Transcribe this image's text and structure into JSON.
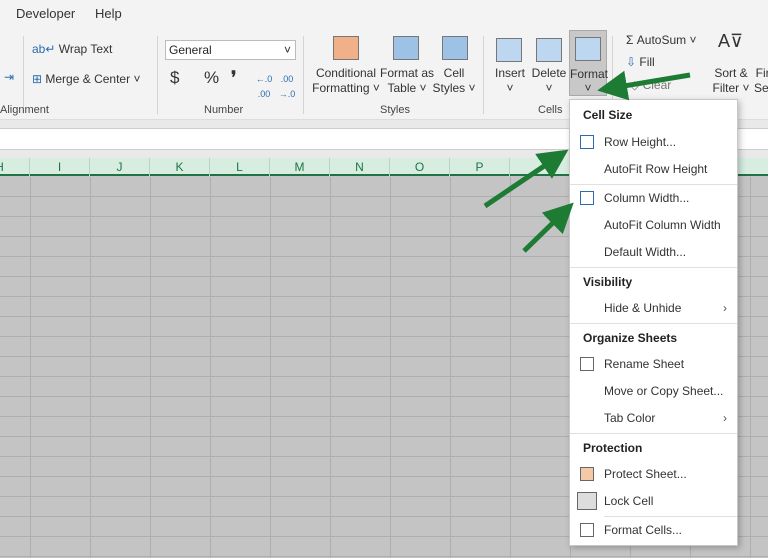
{
  "tabs": [
    "Developer",
    "Help"
  ],
  "ribbon": {
    "wrap_text": "Wrap Text",
    "merge_center": "Merge & Center",
    "alignment": "Alignment",
    "number_format": "General",
    "currency": "$",
    "percent": "%",
    "comma": "❜",
    "inc_dec": "←.0 .00",
    "dec_dec": ".00 →.0",
    "number": "Number",
    "conditional": [
      "Conditional",
      "Formatting ˅"
    ],
    "format_table": [
      "Format as",
      "Table ˅"
    ],
    "cell_styles": [
      "Cell",
      "Styles ˅"
    ],
    "styles": "Styles",
    "insert": "Insert",
    "delete": "Delete",
    "format": "Format",
    "cells": "Cells",
    "autosum": "AutoSum",
    "fill": "Fill",
    "clear": "Clear",
    "sort": [
      "Sort &",
      "Filter ˅"
    ],
    "find": [
      "Fir",
      "Sel"
    ],
    "chev": "˅"
  },
  "columns": [
    "H",
    "I",
    "J",
    "K",
    "L",
    "M",
    "N",
    "O",
    "P"
  ],
  "menu": {
    "cell_size": "Cell Size",
    "row_height": "Row Height...",
    "autofit_row": "AutoFit Row Height",
    "column_width": "Column Width...",
    "autofit_col": "AutoFit Column Width",
    "default_width": "Default Width...",
    "visibility": "Visibility",
    "hide_unhide": "Hide & Unhide",
    "organize": "Organize Sheets",
    "rename": "Rename Sheet",
    "move_copy": "Move or Copy Sheet...",
    "tab_color": "Tab Color",
    "protection": "Protection",
    "protect": "Protect Sheet...",
    "lock": "Lock Cell",
    "format_cells": "Format Cells...",
    "arrow": "›"
  },
  "colors": {
    "accent": "#217346",
    "arrow": "#1e7b34"
  }
}
